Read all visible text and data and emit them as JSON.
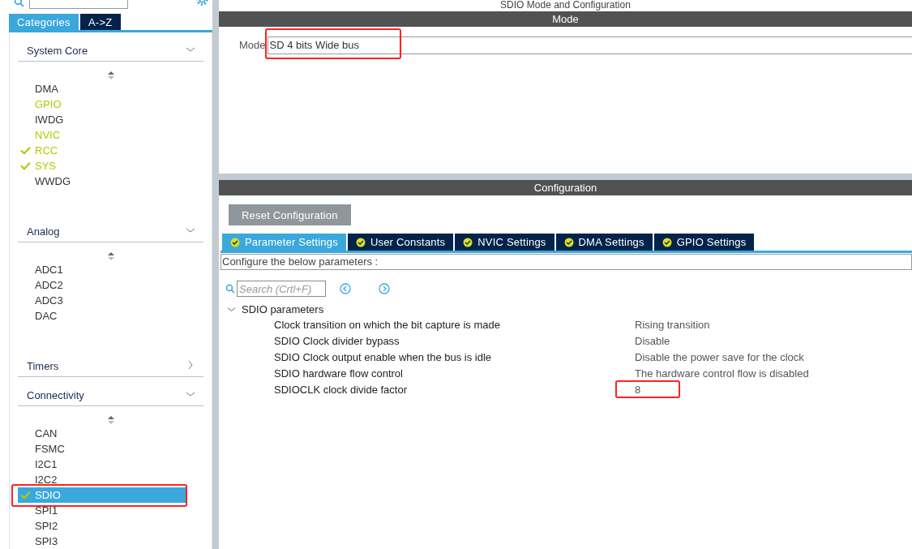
{
  "sidebar": {
    "tabs": [
      {
        "label": "Categories",
        "selected": true
      },
      {
        "label": "A->Z",
        "selected": false
      }
    ],
    "groups": [
      {
        "title": "System Core",
        "expanded": true,
        "items": [
          {
            "label": "DMA",
            "enabled": false,
            "checked": false,
            "selected": false,
            "highlighted": false
          },
          {
            "label": "GPIO",
            "enabled": true,
            "checked": false,
            "selected": false,
            "highlighted": false
          },
          {
            "label": "IWDG",
            "enabled": false,
            "checked": false,
            "selected": false,
            "highlighted": false
          },
          {
            "label": "NVIC",
            "enabled": true,
            "checked": false,
            "selected": false,
            "highlighted": false
          },
          {
            "label": "RCC",
            "enabled": true,
            "checked": true,
            "selected": false,
            "highlighted": false
          },
          {
            "label": "SYS",
            "enabled": true,
            "checked": true,
            "selected": false,
            "highlighted": false
          },
          {
            "label": "WWDG",
            "enabled": false,
            "checked": false,
            "selected": false,
            "highlighted": false
          }
        ]
      },
      {
        "title": "Analog",
        "expanded": true,
        "items": [
          {
            "label": "ADC1",
            "enabled": false,
            "checked": false,
            "selected": false,
            "highlighted": false
          },
          {
            "label": "ADC2",
            "enabled": false,
            "checked": false,
            "selected": false,
            "highlighted": false
          },
          {
            "label": "ADC3",
            "enabled": false,
            "checked": false,
            "selected": false,
            "highlighted": false
          },
          {
            "label": "DAC",
            "enabled": false,
            "checked": false,
            "selected": false,
            "highlighted": false
          }
        ]
      },
      {
        "title": "Timers",
        "expanded": false
      },
      {
        "title": "Connectivity",
        "expanded": true,
        "items": [
          {
            "label": "CAN",
            "enabled": false,
            "checked": false,
            "selected": false,
            "highlighted": false
          },
          {
            "label": "FSMC",
            "enabled": false,
            "checked": false,
            "selected": false,
            "highlighted": false
          },
          {
            "label": "I2C1",
            "enabled": false,
            "checked": false,
            "selected": false,
            "highlighted": false
          },
          {
            "label": "I2C2",
            "enabled": false,
            "checked": false,
            "selected": false,
            "highlighted": false
          },
          {
            "label": "SDIO",
            "enabled": true,
            "checked": true,
            "selected": true,
            "highlighted": true
          },
          {
            "label": "SPI1",
            "enabled": false,
            "checked": false,
            "selected": false,
            "highlighted": false
          },
          {
            "label": "SPI2",
            "enabled": false,
            "checked": false,
            "selected": false,
            "highlighted": false
          },
          {
            "label": "SPI3",
            "enabled": false,
            "checked": false,
            "selected": false,
            "highlighted": false
          }
        ]
      }
    ]
  },
  "title": "SDIO Mode and Configuration",
  "mode": {
    "header": "Mode",
    "label": "Mode",
    "value": "SD 4 bits Wide bus",
    "highlighted": true
  },
  "configuration": {
    "header": "Configuration",
    "reset_button": "Reset Configuration",
    "tabs": [
      {
        "label": "Parameter Settings",
        "selected": true
      },
      {
        "label": "User Constants",
        "selected": false
      },
      {
        "label": "NVIC Settings",
        "selected": false
      },
      {
        "label": "DMA Settings",
        "selected": false
      },
      {
        "label": "GPIO Settings",
        "selected": false
      }
    ],
    "hint": "Configure the below parameters :",
    "search": {
      "placeholder": "Search (Crtl+F)"
    },
    "group": {
      "title": "SDIO parameters",
      "expanded": true,
      "rows": [
        {
          "name": "Clock transition on which the bit capture is made",
          "value": "Rising transition",
          "highlighted": false
        },
        {
          "name": "SDIO Clock divider bypass",
          "value": "Disable",
          "highlighted": false
        },
        {
          "name": "SDIO Clock output enable when the bus is idle",
          "value": "Disable the power save for the clock",
          "highlighted": false
        },
        {
          "name": "SDIO hardware flow control",
          "value": "The hardware control flow is disabled",
          "highlighted": false
        },
        {
          "name": "SDIOCLK clock divide factor",
          "value": "8",
          "highlighted": true
        }
      ]
    }
  }
}
